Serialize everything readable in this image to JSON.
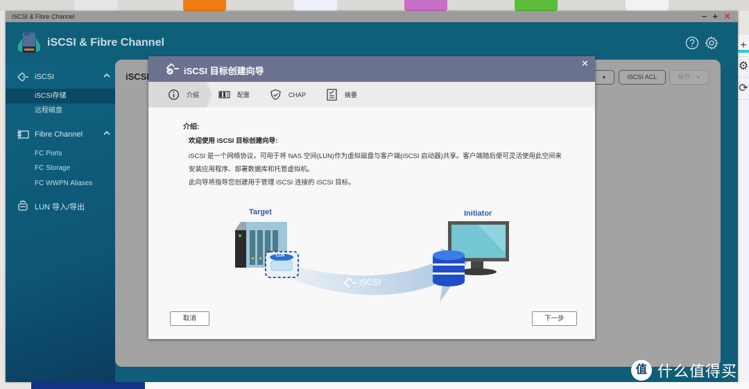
{
  "window": {
    "title": "iSCSI & Fibre Channel",
    "controls": {
      "minimize": "−",
      "maximize": "+",
      "close": "✕"
    }
  },
  "app": {
    "title": "iSCSI & Fibre Channel",
    "icons": [
      "help-icon",
      "settings-gear-icon"
    ]
  },
  "sidebar": {
    "groups": [
      {
        "label": "iSCSI",
        "icon": "iscsi-icon",
        "expanded": true,
        "items": [
          {
            "label": "iSCSI存储",
            "active": true
          },
          {
            "label": "远程磁盘",
            "active": false
          }
        ]
      },
      {
        "label": "Fibre Channel",
        "icon": "fibre-channel-icon",
        "expanded": true,
        "items": [
          {
            "label": "FC Ports"
          },
          {
            "label": "FC Storage"
          },
          {
            "label": "FC WWPN Aliases"
          }
        ]
      },
      {
        "label": "LUN 导入/导出",
        "icon": "lun-import-export-icon",
        "items": []
      }
    ]
  },
  "content": {
    "title": "iSCSI",
    "toolbar": {
      "dropdown_partial": "",
      "acl_button": "iSCSI ACL",
      "actions_button": "操作"
    }
  },
  "dialog": {
    "title": "iSCSI 目标创建向导",
    "close": "✕",
    "steps": [
      {
        "label": "介绍",
        "icon": "info-icon",
        "active": true
      },
      {
        "label": "配置",
        "icon": "config-icon",
        "active": false
      },
      {
        "label": "CHAP",
        "icon": "shield-check-icon",
        "active": false
      },
      {
        "label": "摘要",
        "icon": "clipboard-icon",
        "active": false
      }
    ],
    "intro": {
      "heading": "介绍:",
      "welcome": "欢迎使用 iSCSI 目标创建向导:",
      "paragraph1": "iSCSI 是一个网络协议，可用于将 NAS 空间(LUN)作为虚拟磁盘与客户端(iSCSI 启动器)共享。客户端随后便可灵活使用此空间来安装应用程序、部署数据库和托管虚拟机。",
      "paragraph2": "此向导将指导您创建用于管理 iSCSI 连接的 iSCSI 目标。"
    },
    "diagram": {
      "target_label": "Target",
      "initiator_label": "Initiator",
      "lun_label": "LUN",
      "protocol_label": "iSCSI"
    },
    "buttons": {
      "cancel": "取消",
      "next": "下一步"
    }
  },
  "watermark": {
    "badge": "值",
    "text": "什么值得买"
  },
  "right_strip": {
    "items": [
      "+",
      "⚙",
      "⟳"
    ]
  }
}
